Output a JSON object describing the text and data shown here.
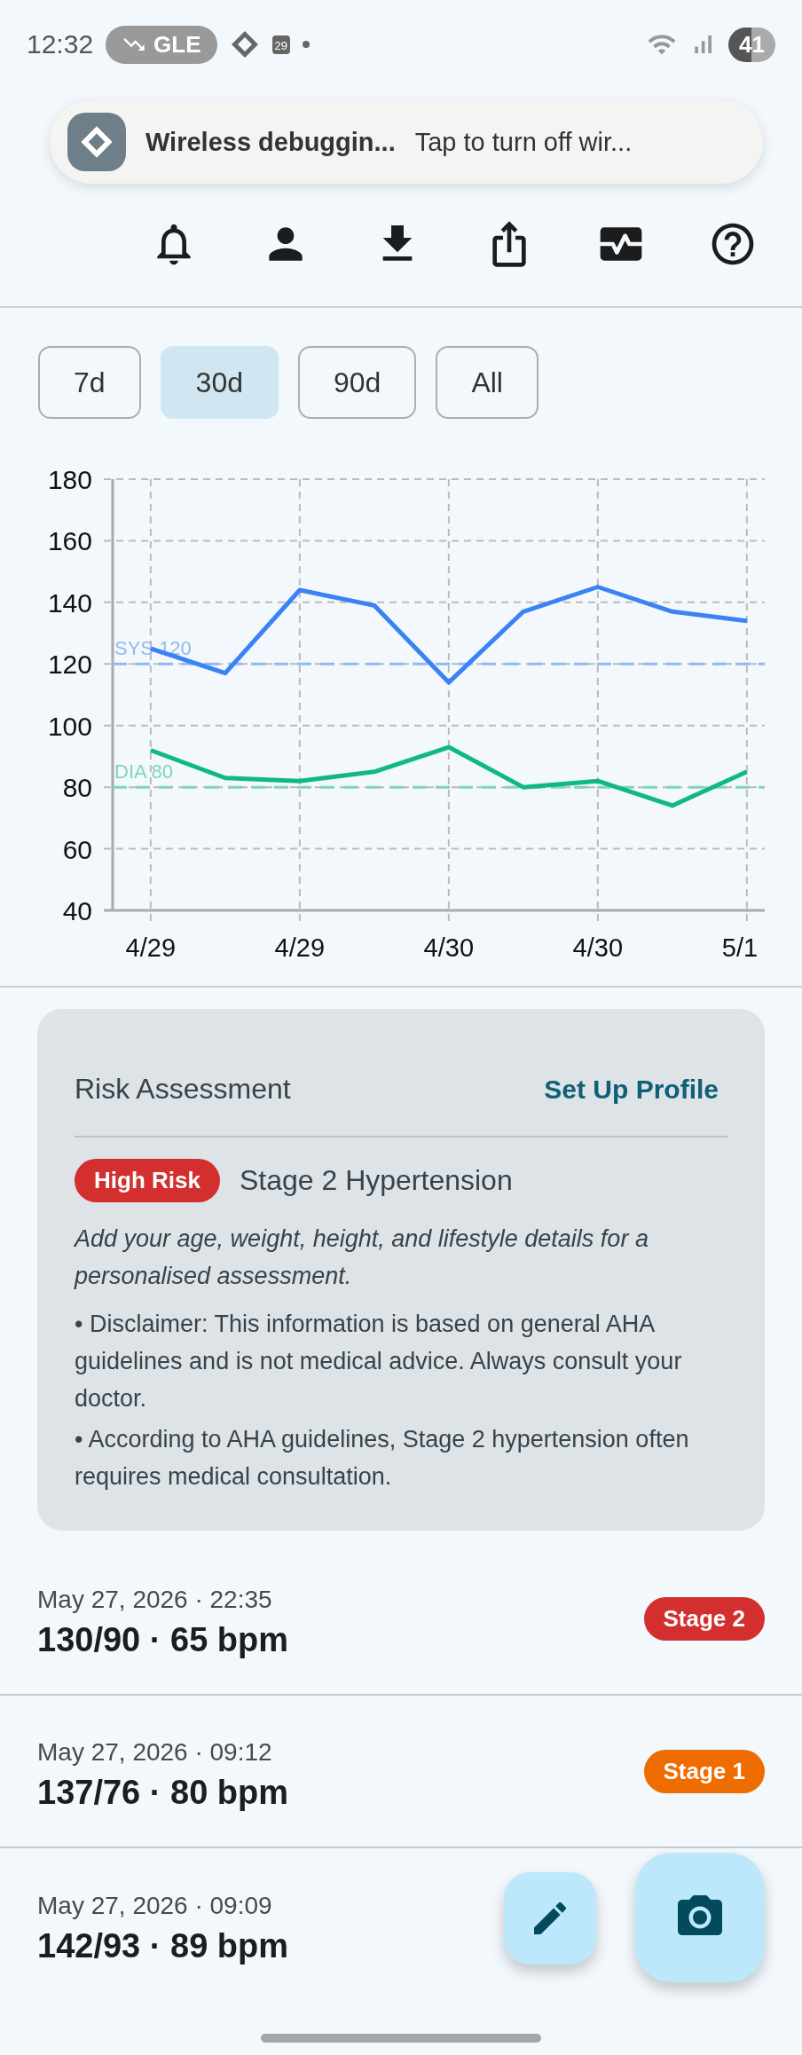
{
  "status_bar": {
    "time": "12:32",
    "pill": "GLE",
    "calendar_day": "29",
    "battery": "41"
  },
  "notification": {
    "title": "Wireless debuggin...",
    "text": "Tap to turn off wir..."
  },
  "ranges": [
    {
      "label": "7d",
      "selected": false
    },
    {
      "label": "30d",
      "selected": true
    },
    {
      "label": "90d",
      "selected": false
    },
    {
      "label": "All",
      "selected": false
    }
  ],
  "chart_data": {
    "type": "line",
    "categories": [
      "4/29",
      null,
      "4/29",
      null,
      "4/30",
      null,
      "4/30",
      null,
      "5/1"
    ],
    "ylim": [
      40,
      180
    ],
    "yticks": [
      40,
      60,
      80,
      100,
      120,
      140,
      160,
      180
    ],
    "series": [
      {
        "color": "#3b82f6",
        "values": [
          125,
          117,
          144,
          139,
          114,
          137,
          145,
          137,
          134
        ]
      },
      {
        "color": "#10b981",
        "values": [
          92,
          83,
          82,
          85,
          93,
          80,
          82,
          74,
          85
        ]
      }
    ],
    "grid": true,
    "ref_lines": [
      {
        "axis": "y",
        "value": 120,
        "label": "SYS 120",
        "color": "#93b8f0"
      },
      {
        "axis": "y",
        "value": 80,
        "label": "DIA 80",
        "color": "#7fd6b5"
      }
    ]
  },
  "risk": {
    "title": "Risk Assessment",
    "action": "Set Up Profile",
    "badge": "High Risk",
    "stage": "Stage 2 Hypertension",
    "hint": "Add your age, weight, height, and lifestyle details for a personalised assessment.",
    "notes": [
      "• Disclaimer: This information is based on general AHA guidelines and is not medical advice. Always consult your doctor.",
      "• According to AHA guidelines, Stage 2 hypertension often requires medical consultation."
    ]
  },
  "readings": [
    {
      "date": "May 27, 2026 · 22:35",
      "value": "130/90 · 65 bpm",
      "badge": "Stage 2",
      "color": "#d32f2f"
    },
    {
      "date": "May 27, 2026 · 09:12",
      "value": "137/76 · 80 bpm",
      "badge": "Stage 1",
      "color": "#ef6c00"
    },
    {
      "date": "May 27, 2026 · 09:09",
      "value": "142/93 · 89 bpm"
    }
  ]
}
